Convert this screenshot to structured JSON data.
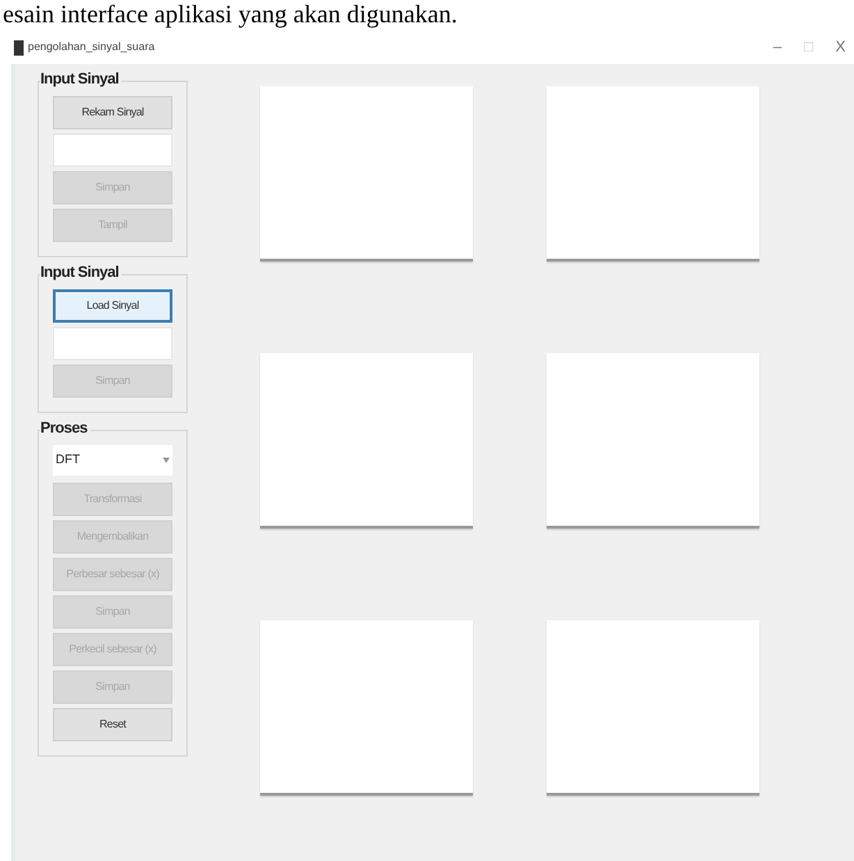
{
  "caption": "esain interface aplikasi yang akan digunakan.",
  "window": {
    "title": "pengolahan_sinyal_suara",
    "controls": [
      {
        "kind": "minimize",
        "label": "–"
      },
      {
        "kind": "maximize",
        "label": "□"
      },
      {
        "kind": "close",
        "label": "X"
      }
    ]
  },
  "panels": [
    {
      "title": "Input Sinyal",
      "items": [
        {
          "kind": "button",
          "label": "Rekam Sinyal",
          "disabled": false,
          "focused": false
        },
        {
          "kind": "field"
        },
        {
          "kind": "button",
          "label": "Simpan",
          "disabled": true,
          "focused": false
        },
        {
          "kind": "button",
          "label": "Tampil",
          "disabled": true,
          "focused": false
        }
      ]
    },
    {
      "title": "Input Sinyal",
      "items": [
        {
          "kind": "button",
          "label": "Load Sinyal",
          "disabled": false,
          "focused": true
        },
        {
          "kind": "field"
        },
        {
          "kind": "button",
          "label": "Simpan",
          "disabled": true,
          "focused": false
        }
      ]
    },
    {
      "title": "Proses",
      "items": [
        {
          "kind": "dropdown",
          "value": "DFT"
        },
        {
          "kind": "button",
          "label": "Transformasi",
          "disabled": true,
          "focused": false
        },
        {
          "kind": "button",
          "label": "Mengembalikan",
          "disabled": true,
          "focused": false
        },
        {
          "kind": "button",
          "label": "Perbesar sebesar (x)",
          "disabled": true,
          "focused": false
        },
        {
          "kind": "button",
          "label": "Simpan",
          "disabled": true,
          "focused": false
        },
        {
          "kind": "button",
          "label": "Perkecil sebesar (x)",
          "disabled": true,
          "focused": false
        },
        {
          "kind": "button",
          "label": "Simpan",
          "disabled": true,
          "focused": false
        },
        {
          "kind": "button",
          "label": "Reset",
          "disabled": false,
          "focused": false
        }
      ]
    }
  ],
  "plots": [
    {
      "kind": "axes"
    },
    {
      "kind": "axes"
    },
    {
      "kind": "axes"
    },
    {
      "kind": "axes"
    },
    {
      "kind": "axes"
    },
    {
      "kind": "axes"
    }
  ]
}
